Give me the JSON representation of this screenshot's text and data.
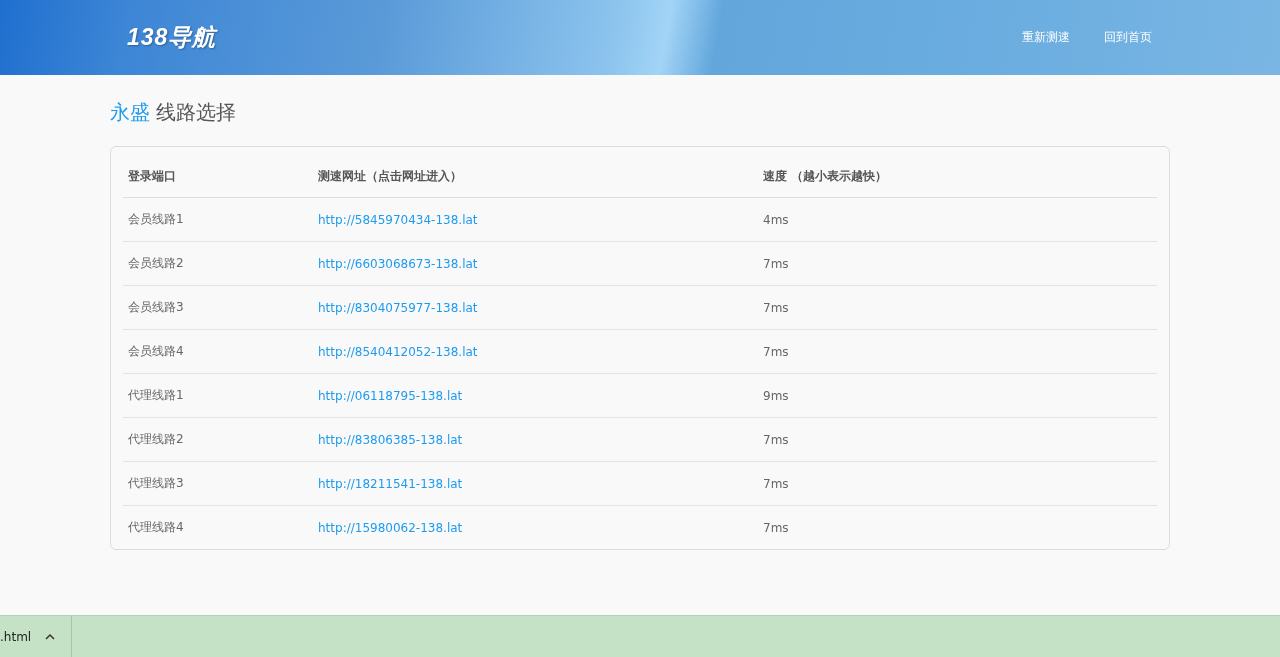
{
  "header": {
    "logo": "138导航",
    "nav": [
      "重新测速",
      "回到首页"
    ]
  },
  "heading": {
    "brand": "永盛",
    "title": "线路选择"
  },
  "table": {
    "columns": [
      "登录端口",
      "测速网址（点击网址进入）",
      "速度 （越小表示越快）"
    ],
    "rows": [
      {
        "name": "会员线路1",
        "url": "http://5845970434-138.lat",
        "speed": "4ms"
      },
      {
        "name": "会员线路2",
        "url": "http://6603068673-138.lat",
        "speed": "7ms"
      },
      {
        "name": "会员线路3",
        "url": "http://8304075977-138.lat",
        "speed": "7ms"
      },
      {
        "name": "会员线路4",
        "url": "http://8540412052-138.lat",
        "speed": "7ms"
      },
      {
        "name": "代理线路1",
        "url": "http://06118795-138.lat",
        "speed": "9ms"
      },
      {
        "name": "代理线路2",
        "url": "http://83806385-138.lat",
        "speed": "7ms"
      },
      {
        "name": "代理线路3",
        "url": "http://18211541-138.lat",
        "speed": "7ms"
      },
      {
        "name": "代理线路4",
        "url": "http://15980062-138.lat",
        "speed": "7ms"
      }
    ]
  },
  "download_bar": {
    "file": ".html"
  }
}
